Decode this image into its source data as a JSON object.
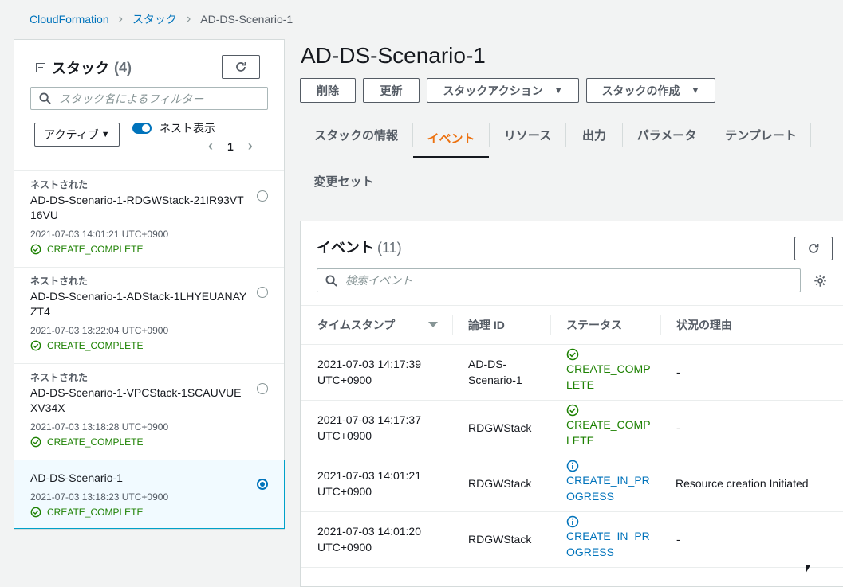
{
  "breadcrumb": {
    "root": "CloudFormation",
    "stacks": "スタック",
    "current": "AD-DS-Scenario-1"
  },
  "left_panel": {
    "title": "スタック",
    "count": "(4)",
    "search_placeholder": "スタック名によるフィルター",
    "filter_select": "アクティブ",
    "nested_toggle_label": "ネスト表示",
    "page": "1",
    "items": [
      {
        "nested": "ネストされた",
        "name": "AD-DS-Scenario-1-RDGWStack-21IR93VT16VU",
        "date": "2021-07-03 14:01:21 UTC+0900",
        "status": "CREATE_COMPLETE"
      },
      {
        "nested": "ネストされた",
        "name": "AD-DS-Scenario-1-ADStack-1LHYEUANAYZT4",
        "date": "2021-07-03 13:22:04 UTC+0900",
        "status": "CREATE_COMPLETE"
      },
      {
        "nested": "ネストされた",
        "name": "AD-DS-Scenario-1-VPCStack-1SCAUVUEXV34X",
        "date": "2021-07-03 13:18:28 UTC+0900",
        "status": "CREATE_COMPLETE"
      },
      {
        "nested": "",
        "name": "AD-DS-Scenario-1",
        "date": "2021-07-03 13:18:23 UTC+0900",
        "status": "CREATE_COMPLETE"
      }
    ]
  },
  "main": {
    "title": "AD-DS-Scenario-1",
    "buttons": {
      "delete": "削除",
      "update": "更新",
      "stack_actions": "スタックアクション",
      "create_stack": "スタックの作成"
    },
    "tabs": [
      "スタックの情報",
      "イベント",
      "リソース",
      "出力",
      "パラメータ",
      "テンプレート",
      "変更セット"
    ],
    "active_tab": "イベント",
    "events": {
      "title": "イベント",
      "count": "(11)",
      "search_placeholder": "検索イベント",
      "columns": [
        "タイムスタンプ",
        "論理 ID",
        "ステータス",
        "状況の理由"
      ],
      "rows": [
        {
          "ts1": "2021-07-03 14:17:39",
          "ts2": "UTC+0900",
          "lid": "AD-DS-Scenario-1",
          "status": "CREATE_COMPLETE",
          "kind": "ok",
          "reason": "-"
        },
        {
          "ts1": "2021-07-03 14:17:37",
          "ts2": "UTC+0900",
          "lid": "RDGWStack",
          "status": "CREATE_COMPLETE",
          "kind": "ok",
          "reason": "-"
        },
        {
          "ts1": "2021-07-03 14:01:21",
          "ts2": "UTC+0900",
          "lid": "RDGWStack",
          "status": "CREATE_IN_PROGRESS",
          "kind": "progress",
          "reason": "Resource creation Initiated"
        },
        {
          "ts1": "2021-07-03 14:01:20",
          "ts2": "UTC+0900",
          "lid": "RDGWStack",
          "status": "CREATE_IN_PROGRESS",
          "kind": "progress",
          "reason": "-"
        }
      ]
    }
  },
  "colors": {
    "link": "#0073bb",
    "success": "#1d8102",
    "active_tab": "#ec7211",
    "selected_border": "#00a1c9"
  }
}
